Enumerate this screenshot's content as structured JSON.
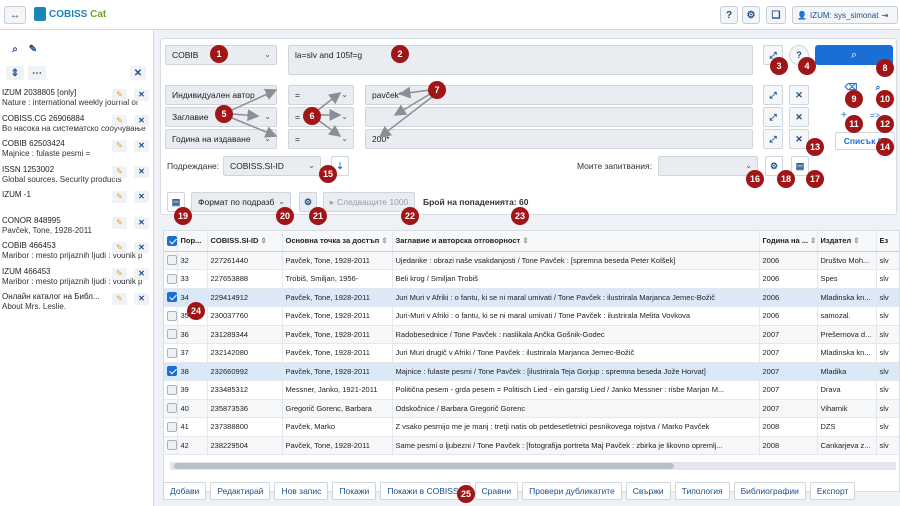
{
  "app": {
    "title": "COBISS Cat",
    "title_a": "COBISS",
    "title_b": "Cat",
    "user": "IZUM: sys_simonat"
  },
  "topbar": {
    "nav_icon": "swap-arrows-icon",
    "help": "?",
    "settings": "settings-icon",
    "book": "book-icon"
  },
  "sidebar": {
    "items": [
      {
        "t1": "IZUM 2038805 [only]",
        "t2": "Nature : international weekly journal of"
      },
      {
        "t1": "COBISS.CG 26906884",
        "t2": "Во насока на систематско сооучување"
      },
      {
        "t1": "COBIB 62503424",
        "t2": "Majnice : fulaste pesmi ="
      },
      {
        "t1": "ISSN 1253002",
        "t2": "Global sources. Security products"
      },
      {
        "t1": "IZUM -1",
        "t2": ""
      },
      {
        "t1": "CONOR 848995",
        "t2": "Pavček, Tone, 1928-2011"
      },
      {
        "t1": "COBIB 466453",
        "t2": "Maribor : mesto prijaznih ljudi : vodnik p"
      },
      {
        "t1": "IZUM 466453",
        "t2": "Maribor : mesto prijaznih ljudi : vodnik p"
      },
      {
        "t1": "Онлайн каталог на Библ...",
        "t2": "About Mrs. Leslie."
      }
    ]
  },
  "search": {
    "database": "COBIB",
    "query": "la=slv and 105f=g",
    "rows": [
      {
        "field": "Индивидуален автор",
        "op": "=",
        "value": "pavček*"
      },
      {
        "field": "Заглавие",
        "op": "=",
        "value": ""
      },
      {
        "field": "Година на издаване",
        "op": "=",
        "value": "200*"
      }
    ],
    "sort_label": "Подреждане:",
    "sort_value": "COBISS.SI-ID",
    "saved_label": "Моите запитвания:",
    "saved_value": "",
    "list_id": "Списък ID",
    "convert_label": "=>"
  },
  "results": {
    "format": "Формат по подразб",
    "next": "Следващите 1000",
    "hits_label": "Брой на попаденията: 60",
    "columns": [
      "Пор...",
      "COBISS.SI-ID",
      "Основна точка за достъп",
      "Заглавие и авторска отговорност",
      "Година на ...",
      "Издател",
      "Ез"
    ],
    "rows": [
      {
        "n": "32",
        "id": "227261440",
        "author": "Pavček, Tone, 1928-2011",
        "title": "Ujedanke : obrazi naše vsakdanjosti / Tone Pavček : [spremna beseda Peter Kolšek]",
        "year": "2006",
        "pub": "Društvo Moh...",
        "lang": "slv",
        "checked": false
      },
      {
        "n": "33",
        "id": "227653888",
        "author": "Trobiš, Smiljan, 1956-",
        "title": "Beli krog / Smiljan Trobiš",
        "year": "2006",
        "pub": "Spes",
        "lang": "slv",
        "checked": false
      },
      {
        "n": "34",
        "id": "229414912",
        "author": "Pavček, Tone, 1928-2011",
        "title": "Juri Muri v Afriki : o fantu, ki se ni maral umivati / Tone Pavček : ilustrirala Marjanca Jemec-Božič",
        "year": "2006",
        "pub": "Mladinska kn...",
        "lang": "slv",
        "checked": true
      },
      {
        "n": "35",
        "id": "230037760",
        "author": "Pavček, Tone, 1928-2011",
        "title": "Juri-Muri v Afriki : o fantu, ki se ni maral umivati / Tone Pavček : ilustrirala Melita Vovkova",
        "year": "2006",
        "pub": "samozal.",
        "lang": "slv",
        "checked": false
      },
      {
        "n": "36",
        "id": "231289344",
        "author": "Pavček, Tone, 1928-2011",
        "title": "Radobesednice / Tone Pavček : naslikala Ančka Gošnik-Godec",
        "year": "2007",
        "pub": "Prešernova d...",
        "lang": "slv",
        "checked": false
      },
      {
        "n": "37",
        "id": "232142080",
        "author": "Pavček, Tone, 1928-2011",
        "title": "Juri Muri drugič v Afriki / Tone Pavček : ilustrirala Marjanca Jemec-Božič",
        "year": "2007",
        "pub": "Mladinska kn...",
        "lang": "slv",
        "checked": false
      },
      {
        "n": "38",
        "id": "232660992",
        "author": "Pavček, Tone, 1928-2011",
        "title": "Majnice : fulaste pesmi / Tone Pavček : [ilustrirala Teja Gorjup : spremna beseda Jože Horvat]",
        "year": "2007",
        "pub": "Mladika",
        "lang": "slv",
        "checked": true
      },
      {
        "n": "39",
        "id": "233485312",
        "author": "Messner, Janko, 1921-2011",
        "title": "Politična pesem - grda pesem = Politisch Lied - ein garstig Lied / Janko Messner : risbe Marjan M...",
        "year": "2007",
        "pub": "Drava",
        "lang": "slv",
        "checked": false
      },
      {
        "n": "40",
        "id": "235873536",
        "author": "Gregorič Gorenc, Barbara",
        "title": "Odskočnice / Barbara Gregorič Gorenc",
        "year": "2007",
        "pub": "Viharnik",
        "lang": "slv",
        "checked": false
      },
      {
        "n": "41",
        "id": "237388800",
        "author": "Pavček, Marko",
        "title": "Z vsako pesmijo me je manj : tretji natis ob petdesetletnici pesnikovega rojstva / Marko Pavček",
        "year": "2008",
        "pub": "DZS",
        "lang": "slv",
        "checked": false
      },
      {
        "n": "42",
        "id": "238229504",
        "author": "Pavček, Tone, 1928-2011",
        "title": "Same pesmi o ljubezni / Tone Pavček : [fotografija portreta Maj Pavček : zbirka je likovno opremlj...",
        "year": "2008",
        "pub": "Cankarjeva z...",
        "lang": "slv",
        "checked": false
      }
    ]
  },
  "buttons": [
    "Добави",
    "Редактирай",
    "Нов запис",
    "Покажи",
    "Покажи в COBISS+",
    "Сравни",
    "Провери дубликатите",
    "Свържи",
    "Типология",
    "Библиографии",
    "Експорт"
  ],
  "badges": [
    "1",
    "2",
    "3",
    "4",
    "5",
    "6",
    "7",
    "8",
    "9",
    "10",
    "11",
    "12",
    "13",
    "14",
    "15",
    "16",
    "17",
    "18",
    "19",
    "20",
    "21",
    "22",
    "23",
    "24",
    "25"
  ],
  "colors": {
    "badge": "#a01518",
    "accent": "#1a6fd6",
    "arrow": "#8a8f96"
  }
}
